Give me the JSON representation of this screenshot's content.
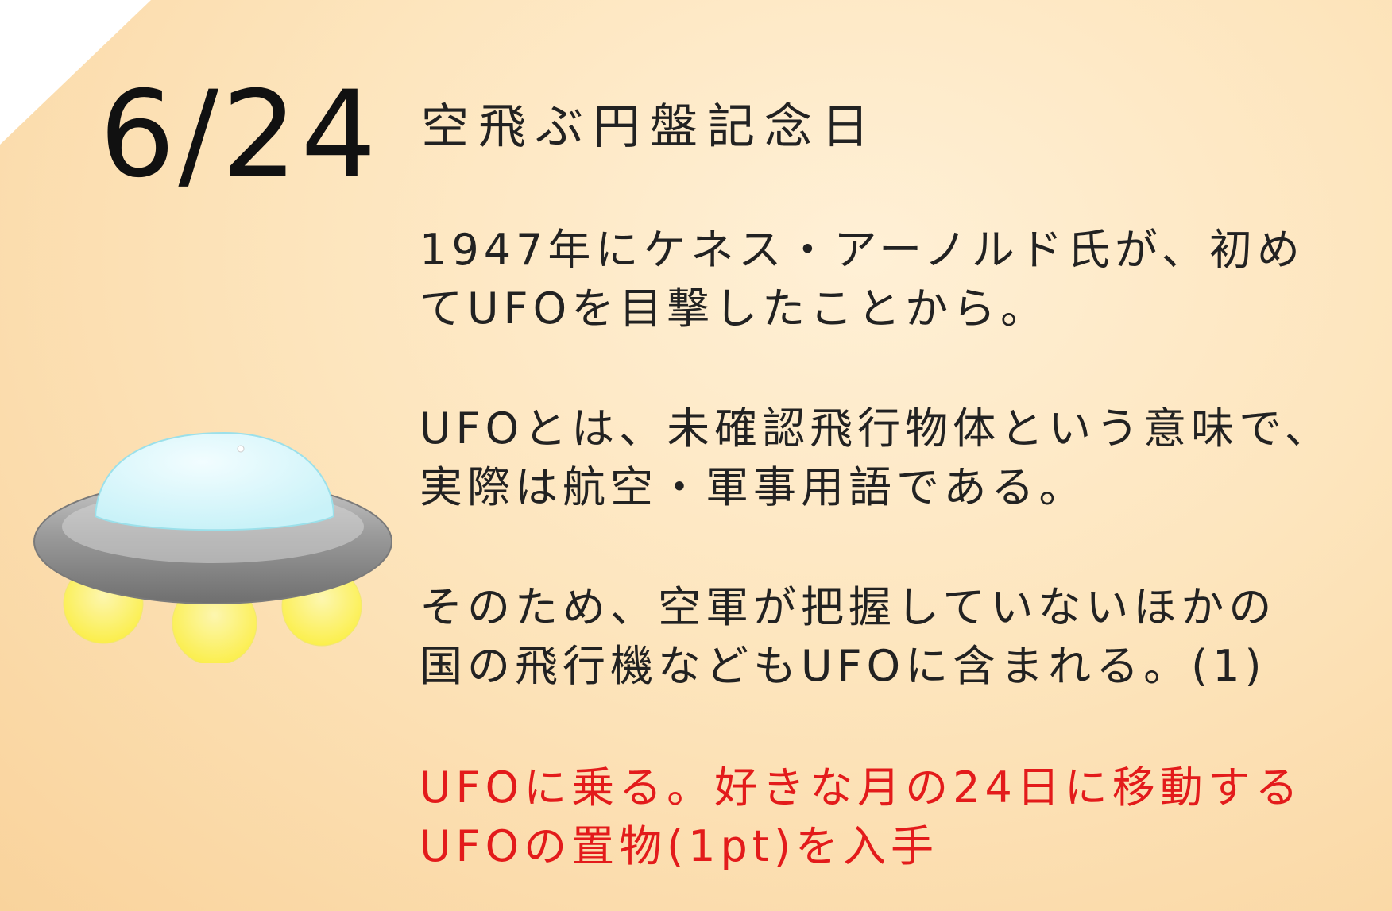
{
  "date": "6/24",
  "title": "空飛ぶ円盤記念日",
  "paragraphs": [
    {
      "lines": [
        "1947年にケネス・アーノルド氏が、初め",
        "てUFOを目撃したことから。"
      ]
    },
    {
      "lines": [
        "UFOとは、未確認飛行物体という意味で、",
        "実際は航空・軍事用語である。"
      ]
    },
    {
      "lines": [
        "そのため、空軍が把握していないほかの",
        "国の飛行機などもUFOに含まれる。(1)"
      ]
    }
  ],
  "reward": {
    "lines": [
      "UFOに乗る。好きな月の24日に移動する",
      "UFOの置物(1pt)を入手"
    ]
  },
  "illustration": {
    "name": "ufo-icon"
  },
  "colors": {
    "background": "#fde5bd",
    "text": "#222222",
    "reward_text": "#e31b1b",
    "dome": "#d8f8fb",
    "saucer": "#9b9b9b",
    "lights": "#fbf74a"
  }
}
